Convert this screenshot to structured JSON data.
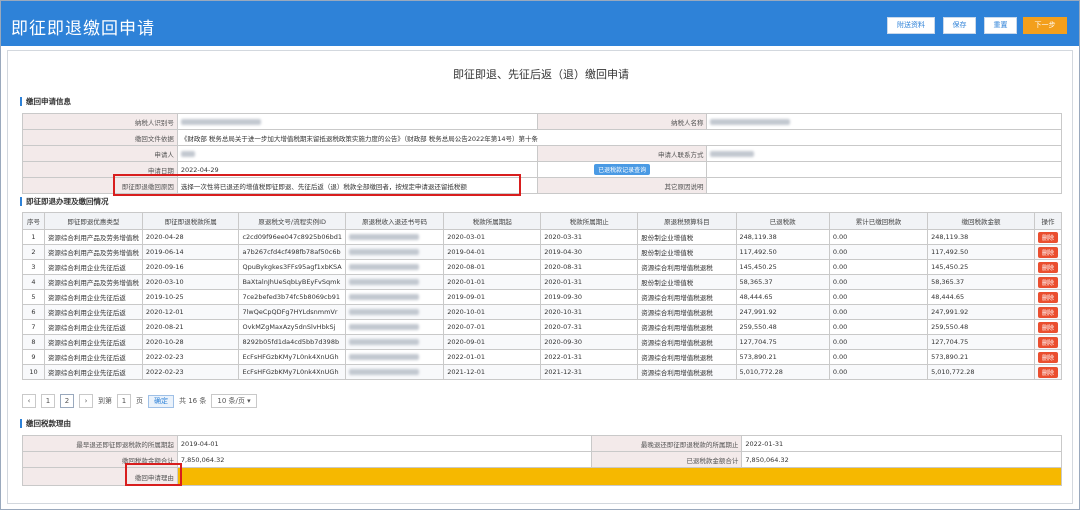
{
  "header": {
    "title": "即征即退缴回申请",
    "buttons": {
      "attach": "附送资料",
      "save": "保存",
      "reset": "重置",
      "next": "下一步"
    }
  },
  "page_title": "即征即退、先征后返（退）缴回申请",
  "sections": {
    "info": "缴回申请信息",
    "handling": "即征即退办理及缴回情况",
    "reason": "缴回税款理由"
  },
  "info": {
    "taxpayer_id_label": "纳税人识别号",
    "taxpayer_name_label": "纳税人名称",
    "policy_label": "缴回文件依据",
    "policy_value": "《财政部 税务总局关于进一步加大增值税期末留抵退税政策实施力度的公告》（财政部 税务总局公告2022年第14号）第十条",
    "applicant_label": "申请人",
    "contact_label": "申请人联系方式",
    "date_label": "申请日期",
    "date_value": "2022-04-29",
    "query_button": "已退税款记录查询",
    "reason_label": "即征即退缴回原因",
    "reason_value": "选择一次性将已退还的增值税即征即退、先征后返（退）税款全部缴回者，按规定申请退还留抵税额",
    "other_reason_label": "其它原因说明"
  },
  "table": {
    "headers": [
      "序号",
      "即征即退优惠类型",
      "即征即退税款所属",
      "原退税文号/流程实例ID",
      "原退税收入退还书号码",
      "税款所属期起",
      "税款所属期止",
      "原退税预算科目",
      "已退税款",
      "累计已缴回税款",
      "缴回税款金额",
      "操作"
    ],
    "rows": [
      {
        "n": "1",
        "type": "资源综合利用产品及劳务增值税",
        "date": "2020-04-28",
        "doc": "c2cd09f96ee047c8925b06bd1",
        "start": "2020-03-01",
        "end": "2020-03-31",
        "subject": "股份制企业增值税",
        "refunded": "248,119.38",
        "returned": "0.00",
        "amount": "248,119.38"
      },
      {
        "n": "2",
        "type": "资源综合利用产品及劳务增值税",
        "date": "2019-06-14",
        "doc": "a7b267cfd4cf498fb78af50c6b",
        "start": "2019-04-01",
        "end": "2019-04-30",
        "subject": "股份制企业增值税",
        "refunded": "117,492.50",
        "returned": "0.00",
        "amount": "117,492.50"
      },
      {
        "n": "3",
        "type": "资源综合利用企业先征后返",
        "date": "2020-09-16",
        "doc": "QpuBykgkes3FFs95agf1xbKSA",
        "start": "2020-08-01",
        "end": "2020-08-31",
        "subject": "资源综合利用增值税退税",
        "refunded": "145,450.25",
        "returned": "0.00",
        "amount": "145,450.25"
      },
      {
        "n": "4",
        "type": "资源综合利用产品及劳务增值税",
        "date": "2020-03-10",
        "doc": "BaXtalnJhUeSqbLyBEyFvSqmk",
        "start": "2020-01-01",
        "end": "2020-01-31",
        "subject": "股份制企业增值税",
        "refunded": "58,365.37",
        "returned": "0.00",
        "amount": "58,365.37"
      },
      {
        "n": "5",
        "type": "资源综合利用企业先征后返",
        "date": "2019-10-25",
        "doc": "7ce2befed3b74fc5b8069cb91",
        "start": "2019-09-01",
        "end": "2019-09-30",
        "subject": "资源综合利用增值税退税",
        "refunded": "48,444.65",
        "returned": "0.00",
        "amount": "48,444.65"
      },
      {
        "n": "6",
        "type": "资源综合利用企业先征后返",
        "date": "2020-12-01",
        "doc": "7lwQeCpQDFg7HYLdsnmmVr",
        "start": "2020-10-01",
        "end": "2020-10-31",
        "subject": "资源综合利用增值税退税",
        "refunded": "247,991.92",
        "returned": "0.00",
        "amount": "247,991.92"
      },
      {
        "n": "7",
        "type": "资源综合利用企业先征后返",
        "date": "2020-08-21",
        "doc": "OvkMZgMaxAzy5dnSlvHbkSj",
        "start": "2020-07-01",
        "end": "2020-07-31",
        "subject": "资源综合利用增值税退税",
        "refunded": "259,550.48",
        "returned": "0.00",
        "amount": "259,550.48"
      },
      {
        "n": "8",
        "type": "资源综合利用企业先征后返",
        "date": "2020-10-28",
        "doc": "8292b05fd1da4cd5bb7d398b",
        "start": "2020-09-01",
        "end": "2020-09-30",
        "subject": "资源综合利用增值税退税",
        "refunded": "127,704.75",
        "returned": "0.00",
        "amount": "127,704.75"
      },
      {
        "n": "9",
        "type": "资源综合利用企业先征后返",
        "date": "2022-02-23",
        "doc": "EcFsHFGzbKMy7L0nk4XnUGh",
        "start": "2022-01-01",
        "end": "2022-01-31",
        "subject": "资源综合利用增值税退税",
        "refunded": "573,890.21",
        "returned": "0.00",
        "amount": "573,890.21"
      },
      {
        "n": "10",
        "type": "资源综合利用企业先征后返",
        "date": "2022-02-23",
        "doc": "EcFsHFGzbKMy7L0nk4XnUGh",
        "start": "2021-12-01",
        "end": "2021-12-31",
        "subject": "资源综合利用增值税退税",
        "refunded": "5,010,772.28",
        "returned": "0.00",
        "amount": "5,010,772.28"
      }
    ],
    "delete_label": "删除"
  },
  "pager": {
    "pages": [
      "1",
      "2"
    ],
    "goto_label": "到第",
    "goto_value": "1",
    "page_unit": "页",
    "confirm": "确定",
    "total": "共 16 条",
    "page_size": "10 条/页"
  },
  "summary": {
    "earliest_start_label": "最早退还即征即退税款的所属期起",
    "earliest_start_value": "2019-04-01",
    "latest_end_label": "最晚退还即征即退税款的所属期止",
    "latest_end_value": "2022-01-31",
    "return_total_label": "缴回税款金额合计",
    "return_total_value": "7,850,064.32",
    "refunded_total_label": "已退税款金额合计",
    "refunded_total_value": "7,850,064.32",
    "reason_label": "缴回申请理由"
  }
}
